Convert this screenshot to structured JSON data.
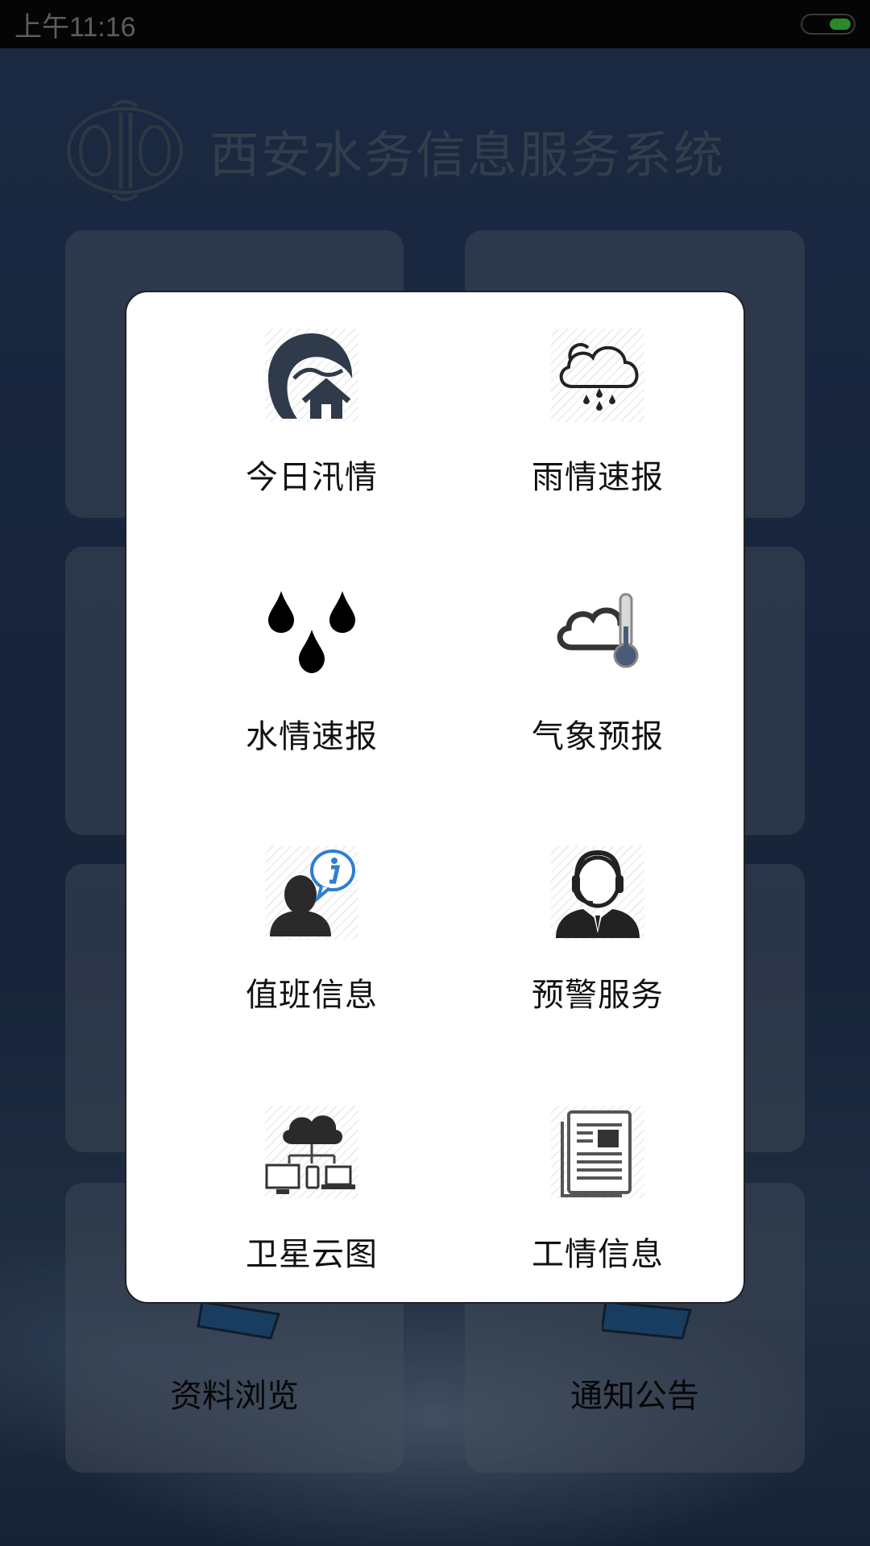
{
  "status_bar": {
    "time": "上午11:16"
  },
  "header": {
    "title": "西安水务信息服务系统"
  },
  "background_tiles": [
    {
      "label": ""
    },
    {
      "label": ""
    },
    {
      "label": ""
    },
    {
      "label": ""
    },
    {
      "label": ""
    },
    {
      "label": ""
    },
    {
      "label": "资料浏览"
    },
    {
      "label": "通知公告"
    }
  ],
  "dialog": {
    "items": [
      {
        "label": "今日汛情",
        "icon": "flood-wave-house-icon"
      },
      {
        "label": "雨情速报",
        "icon": "rain-cloud-icon"
      },
      {
        "label": "水情速报",
        "icon": "water-drops-icon"
      },
      {
        "label": "气象预报",
        "icon": "cloud-thermometer-icon"
      },
      {
        "label": "值班信息",
        "icon": "person-info-icon"
      },
      {
        "label": "预警服务",
        "icon": "headset-operator-icon"
      },
      {
        "label": "卫星云图",
        "icon": "cloud-devices-icon"
      },
      {
        "label": "工情信息",
        "icon": "newspaper-icon"
      }
    ]
  },
  "colors": {
    "dialog_bg": "#ffffff",
    "icon_dark": "#2f3a4a",
    "icon_blue": "#2d7fd0",
    "title_text": "#5f6f8a"
  }
}
